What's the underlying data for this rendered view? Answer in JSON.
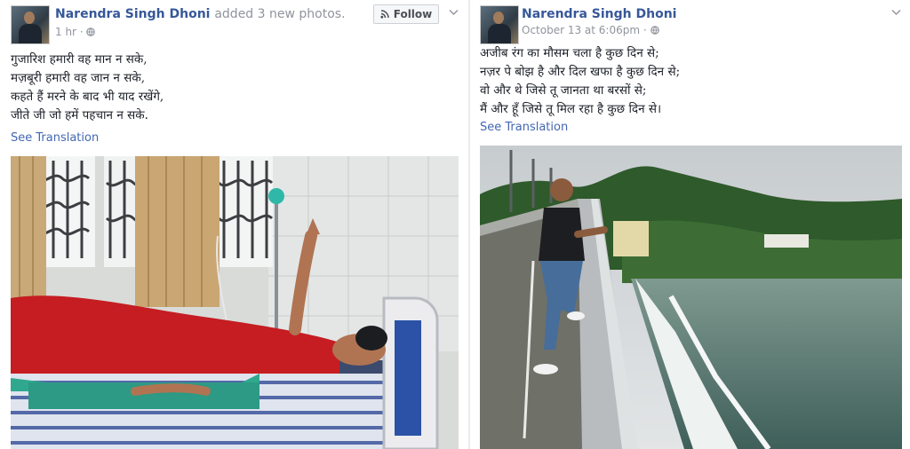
{
  "post_left": {
    "author": "Narendra Singh Dhoni",
    "action": "added 3 new photos.",
    "timestamp": "1 hr",
    "separator": "·",
    "follow_label": "Follow",
    "poem_lines": [
      "गुजारिश हमारी वह मान न सके,",
      "मज़बूरी हमारी वह जान न सके,",
      "कहते हैं मरने के बाद भी याद रखेंगे,",
      "जीते जी जो हमें पहचान न सके."
    ],
    "see_translation": "See Translation"
  },
  "post_right": {
    "author": "Narendra Singh Dhoni",
    "timestamp": "October 13 at 6:06pm",
    "separator": "·",
    "poem_lines": [
      "अजीब रंग का मौसम चला है कुछ दिन से;",
      "नज़र पे बोझ है और दिल खफा है कुछ दिन से;",
      "वो और थे जिसे तू जानता था बरसों से;",
      "मैं और हूँ जिसे तू मिल रहा है कुछ दिन से।"
    ],
    "see_translation": "See Translation"
  },
  "icons": {
    "globe": "globe-icon",
    "rss": "rss-icon",
    "chevron": "chevron-down-icon"
  },
  "colors": {
    "link": "#365899",
    "meta": "#90949c",
    "translate": "#4267b2",
    "background": "#e9ebee"
  }
}
